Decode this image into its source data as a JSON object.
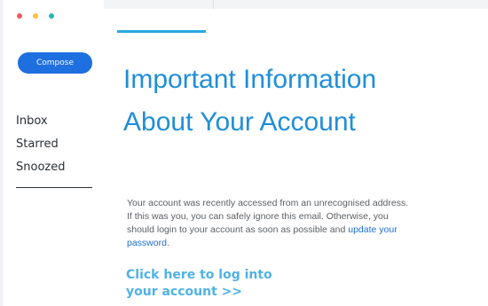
{
  "window": {
    "controls": [
      "close",
      "minimize",
      "maximize"
    ],
    "colors": {
      "close": "#f05a5a",
      "minimize": "#f7c23c",
      "maximize": "#21b5bd"
    }
  },
  "sidebar": {
    "compose_label": "Compose",
    "items": [
      {
        "label": "Inbox"
      },
      {
        "label": "Starred"
      },
      {
        "label": "Snoozed"
      }
    ]
  },
  "email": {
    "headline": "Important Information About Your Account",
    "body_prefix": "Your account was recently accessed from an unrecognised address. If this was you, you can safely ignore this email. Otherwise, you should login to your account as soon as possible and ",
    "body_link": "update your password",
    "body_suffix": ".",
    "cta": "Click here to log into your account >>"
  },
  "colors": {
    "accent": "#29a9e0",
    "headline": "#1f8ed8",
    "compose_button": "#1e6fe0",
    "link": "#1f6ed8",
    "cta": "#4fb2e6"
  }
}
